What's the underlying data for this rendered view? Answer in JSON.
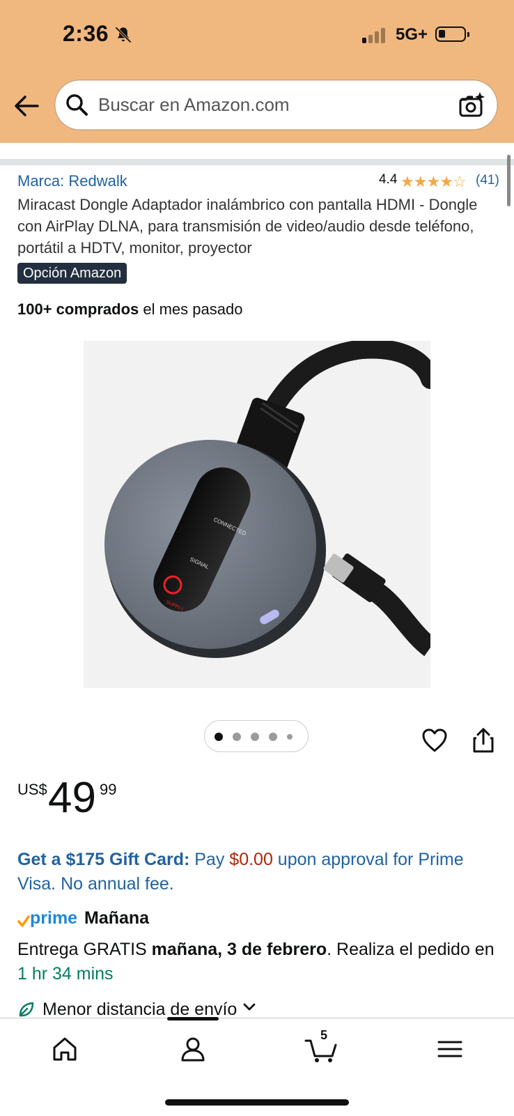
{
  "status_bar": {
    "time": "2:36",
    "network": "5G+",
    "silent_icon": "bell-slash-icon"
  },
  "search": {
    "placeholder": "Buscar en Amazon.com",
    "back_icon": "back-arrow-icon",
    "camera_icon": "camera-sparkle-icon"
  },
  "product": {
    "brand": "Marca: Redwalk",
    "rating": "4.4",
    "stars": 4.4,
    "review_count": "(41)",
    "title": "Miracast Dongle Adaptador inalámbrico con pantalla HDMI - Dongle con AirPlay DLNA, para transmisión de video/audio desde teléfono, portátil a HDTV, monitor, proyector",
    "badge": "Opción Amazon",
    "bought_bold": "100+ comprados",
    "bought_rest": " el mes pasado",
    "image_labels": {
      "connected": "CONNECTED",
      "signal": "SIGNAL",
      "supply": "SUPPLY"
    },
    "carousel_total": 5,
    "carousel_active": 1
  },
  "price": {
    "currency": "US$",
    "whole": "49",
    "fraction": "99"
  },
  "promo": {
    "bold": "Get a $175 Gift Card:",
    "text1": " Pay ",
    "amount": "$0.00",
    "text2": " upon approval for Prime Visa. No annual fee."
  },
  "delivery": {
    "prime_word": "prime",
    "prime_day": "Mañana",
    "text1": "Entrega GRATIS ",
    "date_bold": "mañana, 3 de febrero",
    "text2": ". Realiza el pedido en ",
    "time_left": "1 hr 34 mins",
    "eco_label": "Menor distancia de envío"
  },
  "bottom_nav": {
    "items": [
      "home-icon",
      "account-icon",
      "cart-icon",
      "menu-icon"
    ],
    "cart_count": "5"
  },
  "colors": {
    "header": "#f0b87f",
    "link": "#2162a1",
    "price_red": "#b12704",
    "star": "#f3a847",
    "prime_blue": "#1e88d7",
    "green": "#067d62"
  }
}
